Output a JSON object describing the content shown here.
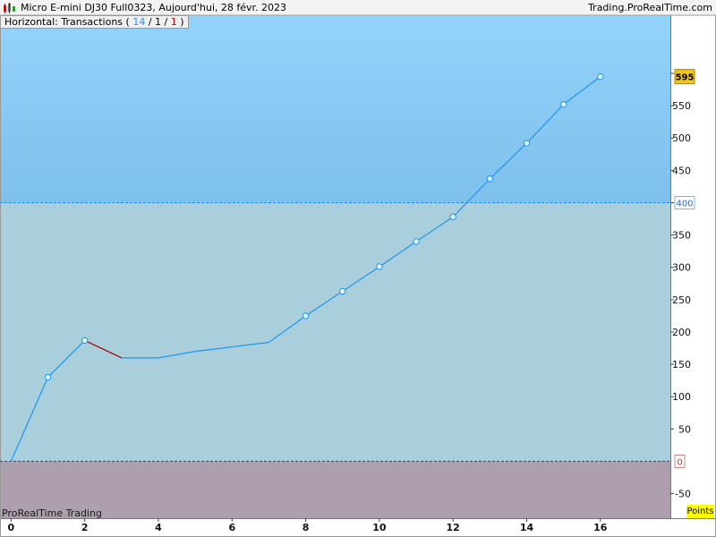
{
  "window": {
    "title": "Micro E-mini DJ30 Full0323, Aujourd'hui, 28 févr. 2023",
    "site": "Trading.ProRealTime.com"
  },
  "legend": {
    "label": "Horizontal: Transactions",
    "open_paren": "(",
    "count_total": "14",
    "sep1": "/",
    "count_neutral": "1",
    "sep2": "/",
    "count_losing": "1",
    "close_paren": ")"
  },
  "watermark": "ProRealTime Trading",
  "y_unit_label": "Points",
  "colors": {
    "upper_zone": "#8dcdf5",
    "middle_zone": "#a9cfdc",
    "lower_zone": "#ad9fae",
    "line_up": "#1e96f0",
    "line_down": "#a80000",
    "marker_fill": "#dff2ff",
    "upper_threshold": "#1e90ff",
    "zero_line": "#3030d0",
    "last_value_badge": "#f0c419"
  },
  "chart_data": {
    "type": "line",
    "x": [
      0,
      1,
      2,
      3,
      4,
      5,
      6,
      7,
      8,
      9,
      10,
      11,
      12,
      13,
      14,
      15,
      16
    ],
    "y": [
      0,
      130,
      187,
      160,
      160,
      170,
      177,
      184,
      225,
      263,
      301,
      340,
      378,
      437,
      492,
      552,
      595
    ],
    "markers": [
      false,
      true,
      true,
      false,
      false,
      false,
      false,
      false,
      true,
      true,
      true,
      true,
      true,
      true,
      true,
      true,
      true
    ],
    "xlim": [
      -0.3,
      17.9
    ],
    "ylim": [
      -88,
      690
    ],
    "x_ticks": [
      "0",
      "2",
      "4",
      "6",
      "8",
      "10",
      "12",
      "14",
      "16"
    ],
    "y_ticks": [
      "-50",
      "50",
      "100",
      "150",
      "200",
      "250",
      "300",
      "350",
      "400",
      "450",
      "500",
      "550",
      "600"
    ],
    "y_tick_labels": [
      "-50",
      "50",
      "100",
      "150",
      "200",
      "250",
      "300",
      "350",
      "450",
      "500",
      "550"
    ],
    "reference_lines": [
      {
        "value": 400,
        "label": "400"
      },
      {
        "value": 0,
        "label": "0"
      }
    ],
    "last_value_label": "595"
  }
}
